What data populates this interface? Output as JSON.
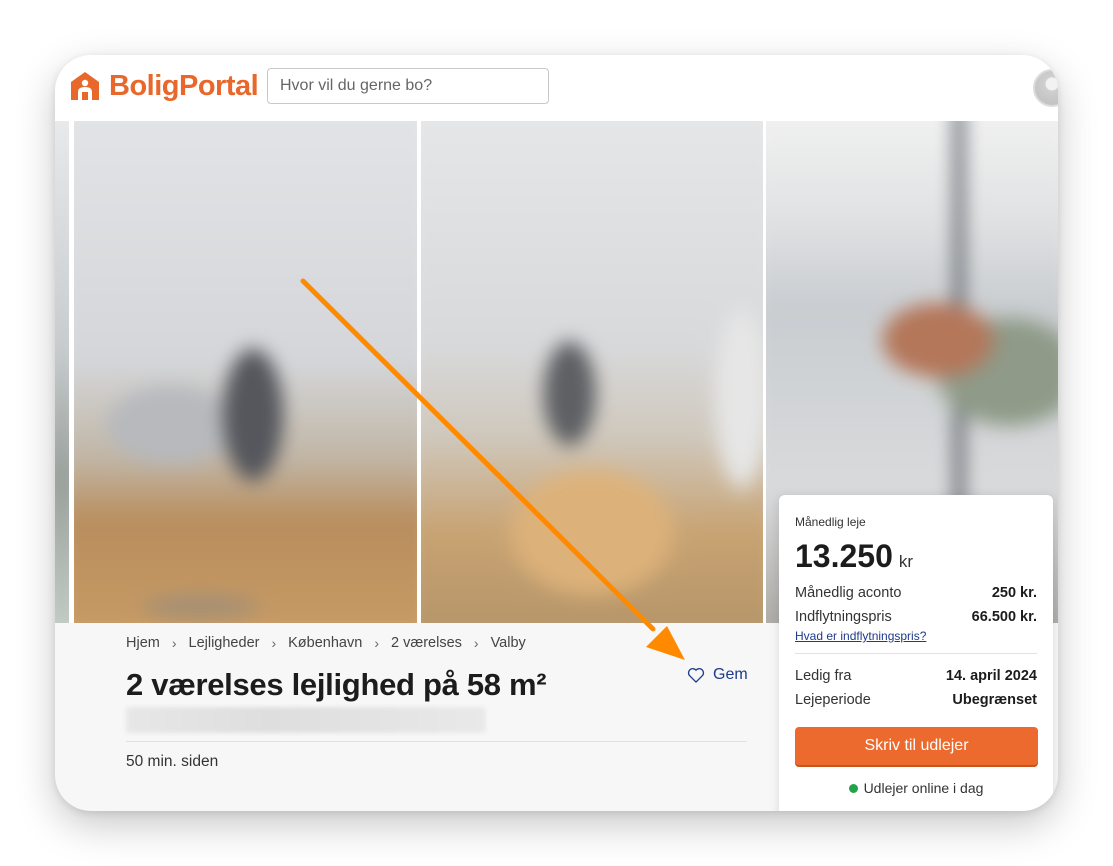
{
  "brand": {
    "name": "BoligPortal",
    "icon": "house-logo-icon",
    "color": "#e8682c"
  },
  "search": {
    "placeholder": "Hvor vil du gerne bo?"
  },
  "breadcrumb": [
    {
      "label": "Hjem"
    },
    {
      "label": "Lejligheder"
    },
    {
      "label": "København"
    },
    {
      "label": "2 værelses"
    },
    {
      "label": "Valby"
    }
  ],
  "listing": {
    "title": "2 værelses lejlighed på 58 m²",
    "save_label": "Gem",
    "posted": "50 min. siden"
  },
  "price_card": {
    "monthly_rent_label": "Månedlig leje",
    "monthly_rent_value": "13.250",
    "currency": "kr",
    "rows": [
      {
        "label": "Månedlig aconto",
        "value": "250 kr."
      },
      {
        "label": "Indflytningspris",
        "value": "66.500 kr."
      }
    ],
    "help_link": "Hvad er indflytningspris?",
    "availability": [
      {
        "label": "Ledig fra",
        "value": "14. april 2024"
      },
      {
        "label": "Lejeperiode",
        "value": "Ubegrænset"
      }
    ],
    "cta_label": "Skriv til udlejer",
    "online_status": "Udlejer online i dag",
    "cta_color": "#ec6a2d",
    "online_color": "#22a34a"
  },
  "annotation": {
    "arrow_color": "#ff8a00"
  }
}
